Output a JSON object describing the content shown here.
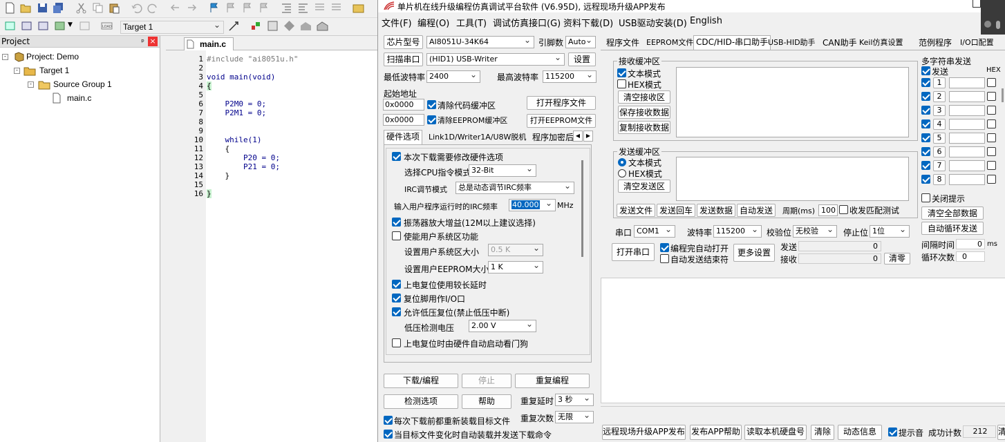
{
  "ide": {
    "target_select": "Target 1",
    "project_header": "Project",
    "project_header_pin": "ᵖ",
    "project_header_close": "×",
    "tree": {
      "project": "Project: Demo",
      "target": "Target 1",
      "group": "Source Group 1",
      "file": "main.c"
    },
    "editor_tab": "main.c",
    "line_numbers": [
      "1",
      "2",
      "3",
      "4",
      "5",
      "6",
      "7",
      "8",
      "9",
      "10",
      "11",
      "12",
      "13",
      "14",
      "15",
      "16"
    ],
    "code": [
      "#include \"ai8051u.h\"",
      "",
      "void main(void)",
      "{",
      "",
      "    P2M0 = 0;",
      "    P2M1 = 0;",
      "",
      "",
      "    while(1)",
      "    {",
      "        P20 = 0;",
      "        P21 = 0;",
      "    }",
      "",
      "}"
    ]
  },
  "app": {
    "title": "单片机在线升级编程仿真调试平台软件 (V6.95D), 远程现场升级APP发布",
    "menu": [
      "文件(F)",
      "编程(O)",
      "工具(T)",
      "调试仿真接口(G)",
      "资料下载(D)",
      "USB驱动安装(D)",
      "English"
    ],
    "chip_button": "芯片型号",
    "chip_value": "AI8051U-34K64",
    "pin_label": "引脚数",
    "pin_value": "Auto",
    "scan_button": "扫描串口",
    "port_value": "(HID1) USB-Writer",
    "settings_button": "设置",
    "min_baud_label": "最低波特率",
    "min_baud_value": "2400",
    "max_baud_label": "最高波特率",
    "max_baud_value": "115200",
    "start_addr_label": "起始地址",
    "addr1": "0x0000",
    "addr2": "0x0000",
    "clear_code_label": "清除代码缓冲区",
    "clear_eeprom_label": "清除EEPROM缓冲区",
    "open_prog_button": "打开程序文件",
    "open_eeprom_button": "打开EEPROM文件",
    "left_tabs": [
      "硬件选项",
      "Link1D/Writer1A/U8W脱机",
      "程序加密后"
    ],
    "hw": {
      "modify_label": "本次下载需要修改硬件选项",
      "cpu_mode_label": "选择CPU指令模式",
      "cpu_mode_value": "32-Bit",
      "irc_mode_label": "IRC调节模式",
      "irc_mode_value": "总是动态调节IRC频率",
      "irc_freq_label": "输入用户程序运行时的IRC频率",
      "irc_freq_value": "40.000",
      "irc_unit": "MHz",
      "osc_gain_label": "振荡器放大增益(12M以上建议选择)",
      "user_sys_label": "使能用户系统区功能",
      "user_sys_size_label": "设置用户系统区大小",
      "user_sys_size_value": "0.5 K",
      "eeprom_size_label": "设置用户EEPROM大小",
      "eeprom_size_value": "1  K",
      "long_delay_label": "上电复位使用较长延时",
      "reset_io_label": "复位脚用作I/O口",
      "lvr_label": "允许低压复位(禁止低压中断)",
      "lvd_label": "低压检测电压",
      "lvd_value": "2.00 V",
      "wdt_label": "上电复位时由硬件自动启动看门狗"
    },
    "download_button": "下载/编程",
    "stop_button": "停止",
    "reprogram_button": "重复编程",
    "check_button": "检测选项",
    "help_button": "帮助",
    "repeat_delay_label": "重复延时",
    "repeat_delay_value": "3 秒",
    "repeat_count_label": "重复次数",
    "repeat_count_value": "无限",
    "reload_label": "每次下载前都重新装载目标文件",
    "auto_reload_label": "当目标文件变化时自动装载并发送下载命令",
    "right_tabs": [
      "程序文件",
      "EEPROM文件",
      "CDC/HID-串口助手",
      "USB-HID助手",
      "CAN助手",
      "Keil仿真设置",
      "范例程序",
      "I/O口配置"
    ],
    "recv": {
      "title": "接收缓冲区",
      "text_mode": "文本模式",
      "hex_mode": "HEX模式",
      "clear": "清空接收区",
      "save": "保存接收数据",
      "copy": "复制接收数据"
    },
    "send": {
      "title": "发送缓冲区",
      "text_mode": "文本模式",
      "hex_mode": "HEX模式",
      "clear": "清空发送区"
    },
    "send_file": "发送文件",
    "send_cr": "发送回车",
    "send_data": "发送数据",
    "auto_send": "自动发送",
    "period_label": "周期(ms)",
    "period_value": "100",
    "match_label": "收发匹配测试",
    "port_label": "串口",
    "com_value": "COM1",
    "baud_label": "波特率",
    "baud_value": "115200",
    "parity_label": "校验位",
    "parity_value": "无校验",
    "stop_label": "停止位",
    "stop_value": "1位",
    "open_port": "打开串口",
    "auto_open_label": "编程完自动打开",
    "auto_close_label": "自动发送结束符",
    "more_settings": "更多设置",
    "send_count_label": "发送",
    "send_count": "0",
    "recv_count_label": "接收",
    "recv_count": "0",
    "clear_count": "清零",
    "multi": {
      "title": "多字符串发送",
      "send_label": "发送",
      "hex_label": "HEX",
      "rows": [
        "1",
        "2",
        "3",
        "4",
        "5",
        "6",
        "7",
        "8"
      ],
      "close_hint": "关闭提示",
      "clear_all": "清空全部数据",
      "auto_loop": "自动循环发送",
      "interval_label": "间隔时间",
      "interval_value": "0",
      "interval_unit": "ms",
      "loop_label": "循环次数",
      "loop_value": "0"
    },
    "bottom": {
      "remote": "远程现场升级APP发布",
      "help": "发布APP帮助",
      "disk": "读取本机硬盘号",
      "clear": "清除",
      "dynamic": "动态信息",
      "beep_label": "提示音",
      "success_label": "成功计数",
      "success_value": "212",
      "clear2": "清零"
    }
  }
}
